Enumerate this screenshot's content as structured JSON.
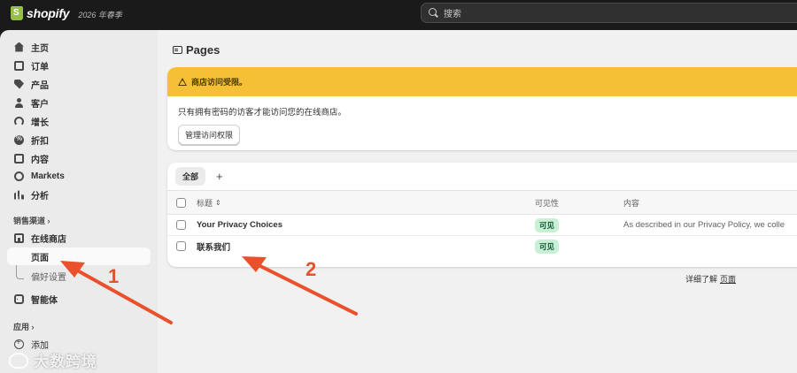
{
  "topbar": {
    "logo_text": "shopify",
    "edition": "2026 年春季",
    "search_placeholder": "搜索"
  },
  "sidebar": {
    "items": [
      {
        "label": "主页",
        "icon": "home-icon"
      },
      {
        "label": "订单",
        "icon": "inbox-icon"
      },
      {
        "label": "产品",
        "icon": "tag-icon"
      },
      {
        "label": "客户",
        "icon": "person-icon"
      },
      {
        "label": "增长",
        "icon": "gauge-icon"
      },
      {
        "label": "折扣",
        "icon": "discount-icon"
      },
      {
        "label": "内容",
        "icon": "content-icon"
      },
      {
        "label": "Markets",
        "icon": "globe-icon"
      },
      {
        "label": "分析",
        "icon": "bar-chart-icon"
      }
    ],
    "sales_channels_title": "销售渠道 ›",
    "online_store": "在线商店",
    "pages": "页面",
    "preferences": "偏好设置",
    "agents": "智能体",
    "apps_title": "应用 ›",
    "add": "添加"
  },
  "main": {
    "title": "Pages",
    "banner": {
      "heading": "商店访问受限。",
      "body": "只有拥有密码的访客才能访问您的在线商店。",
      "button": "管理访问权限"
    },
    "table": {
      "tab_all": "全部",
      "tab_add": "+",
      "columns": [
        "标题",
        "可见性",
        "内容"
      ],
      "rows": [
        {
          "title": "Your Privacy Choices",
          "visibility": "可见",
          "content": "As described in our Privacy Policy, we colle"
        },
        {
          "title": "联系我们",
          "visibility": "可见",
          "content": ""
        }
      ]
    },
    "learn_more_prefix": "详细了解",
    "learn_more_link": "页面"
  },
  "annotations": {
    "label_1": "1",
    "label_2": "2",
    "arrow_color": "#e9502b"
  },
  "watermark": "大数跨境",
  "colors": {
    "banner_yellow": "#f6c036",
    "badge_green": "#c8f0d4",
    "topbar": "#1a1a1a"
  }
}
